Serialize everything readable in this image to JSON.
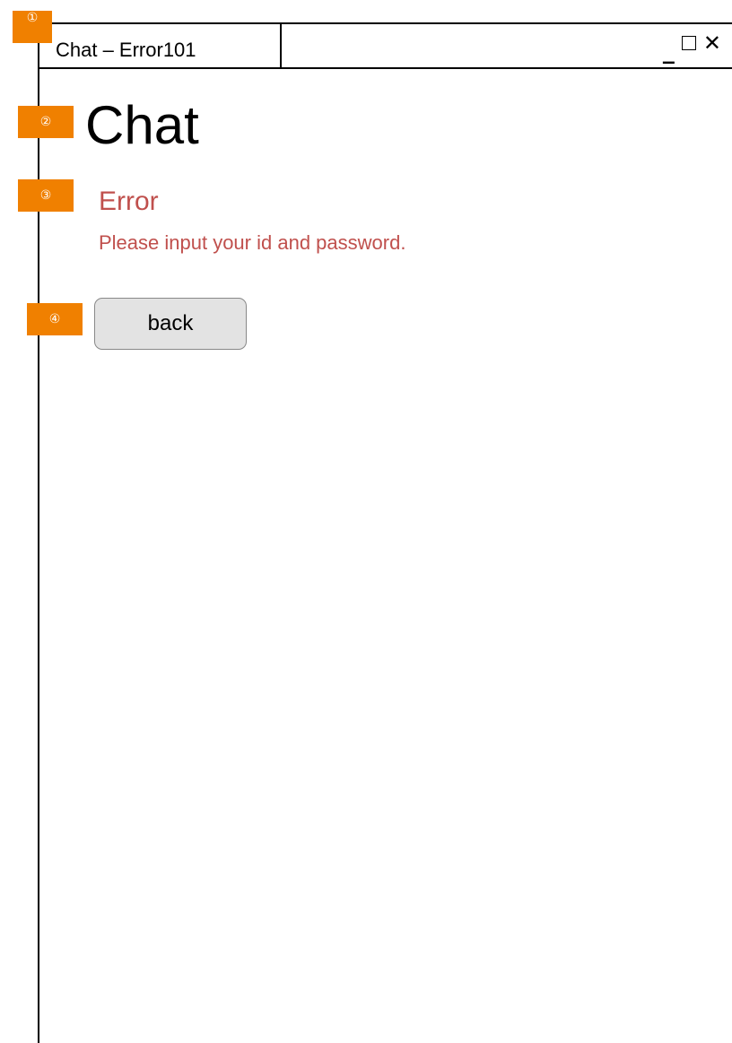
{
  "window": {
    "tab_title": "Chat – Error101",
    "controls": {
      "minimize_glyph": "_",
      "maximize_icon": "maximize-icon",
      "close_glyph": "✕"
    }
  },
  "markers": [
    "①",
    "②",
    "③",
    "④"
  ],
  "page": {
    "title": "Chat"
  },
  "error": {
    "heading": "Error",
    "message": "Please input your id and password."
  },
  "actions": {
    "back_label": "back"
  },
  "colors": {
    "marker": "#f08000",
    "error_text": "#c0504d",
    "button_bg": "#e3e3e3",
    "button_border": "#888888"
  }
}
